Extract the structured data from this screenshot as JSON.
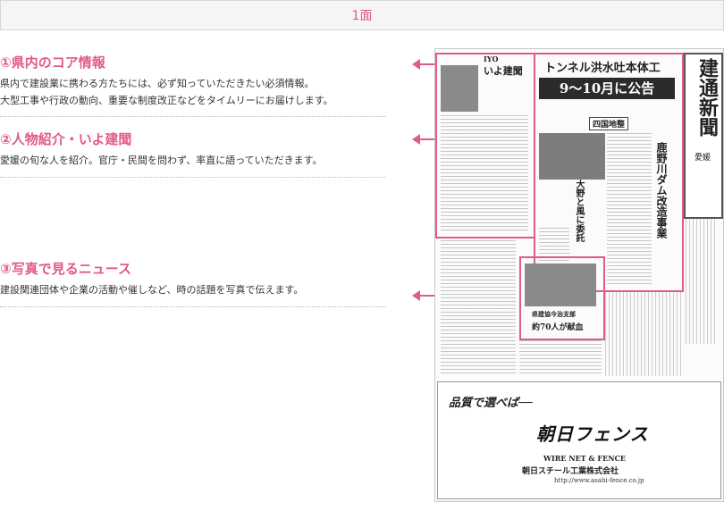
{
  "header": {
    "title": "1面"
  },
  "sections": [
    {
      "title": "①県内のコア情報",
      "lines": [
        "県内で建設業に携わる方たちには、必ず知っていただきたい必須情報。",
        "大型工事や行政の動向、重要な制度改正などをタイムリーにお届けします。"
      ]
    },
    {
      "title": "②人物紹介・いよ建聞",
      "lines": [
        "愛媛の旬な人を紹介。官庁・民間を問わず、率直に語っていただきます。"
      ]
    },
    {
      "title": "③写真で見るニュース",
      "lines": [
        "建設関連団体や企業の活動や催しなど、時の話題を写真で伝えます。"
      ]
    }
  ],
  "newspaper": {
    "masthead": "建通新聞",
    "region": "愛媛",
    "headline": "トンネル洪水吐本体工",
    "headline_banner": "9～10月に公告",
    "sub_headline": "鹿野川ダム改造事業",
    "column_tag": "四国地整",
    "column_title": "いよ建聞",
    "column_brand": "IYO",
    "column_heading": "大野と風に委託",
    "photo_caption": "県建協今治支部",
    "photo_headline": "約70人が献血",
    "ad": {
      "slogan": "品質で選べば──",
      "brand": "朝日フェンス",
      "wire": "WIRE NET & FENCE",
      "company": "朝日スチール工業株式会社",
      "url": "http://www.asahi-fence.co.jp"
    }
  }
}
